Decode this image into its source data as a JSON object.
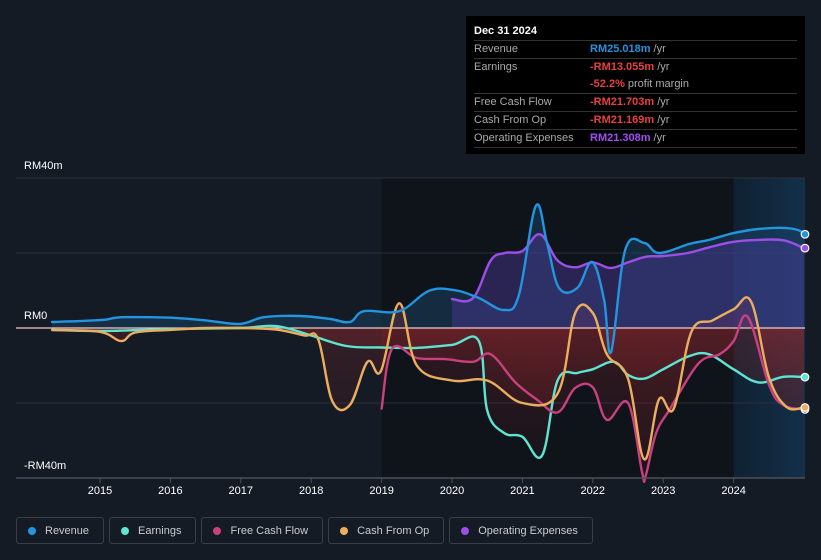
{
  "tooltip": {
    "date": "Dec 31 2024",
    "rows": [
      {
        "label": "Revenue",
        "value": "RM25.018m",
        "unit": "/yr",
        "color": "#2394df"
      },
      {
        "label": "Earnings",
        "value": "-RM13.055m",
        "unit": "/yr",
        "color": "#e64141"
      },
      {
        "label": "",
        "value": "-52.2%",
        "unit": "profit margin",
        "color": "#e64141"
      },
      {
        "label": "Free Cash Flow",
        "value": "-RM21.703m",
        "unit": "/yr",
        "color": "#e64141"
      },
      {
        "label": "Cash From Op",
        "value": "-RM21.169m",
        "unit": "/yr",
        "color": "#e64141"
      },
      {
        "label": "Operating Expenses",
        "value": "RM21.308m",
        "unit": "/yr",
        "color": "#a04ef0"
      }
    ]
  },
  "legend": [
    {
      "label": "Revenue",
      "color": "#2394df"
    },
    {
      "label": "Earnings",
      "color": "#5ee5d2"
    },
    {
      "label": "Free Cash Flow",
      "color": "#c9407f"
    },
    {
      "label": "Cash From Op",
      "color": "#eaae5e"
    },
    {
      "label": "Operating Expenses",
      "color": "#9d4ee8"
    }
  ],
  "chart_data": {
    "type": "line",
    "title": "",
    "xlabel": "",
    "ylabel": "",
    "y_tick_labels": [
      "RM40m",
      "RM0",
      "-RM40m"
    ],
    "ylim": [
      -40,
      40
    ],
    "xlim": [
      2014.3,
      2025.0
    ],
    "x_tick_labels": [
      "2015",
      "2016",
      "2017",
      "2018",
      "2019",
      "2020",
      "2021",
      "2022",
      "2023",
      "2024"
    ],
    "x_ticks": [
      2015,
      2016,
      2017,
      2018,
      2019,
      2020,
      2021,
      2022,
      2023,
      2024
    ],
    "grid": true,
    "forecast_shade_from": 2024.0,
    "legend_position": "bottom-left",
    "series": [
      {
        "name": "Revenue",
        "color": "#2394df",
        "fill": true,
        "x": [
          2014.32,
          2015.0,
          2015.21,
          2015.43,
          2016.07,
          2016.56,
          2016.99,
          2017.34,
          2017.84,
          2018.27,
          2018.55,
          2018.75,
          2019.25,
          2019.67,
          2020.03,
          2020.38,
          2020.74,
          2020.95,
          2021.19,
          2021.35,
          2021.52,
          2021.78,
          2021.99,
          2022.16,
          2022.26,
          2022.46,
          2022.73,
          2022.94,
          2023.37,
          2023.65,
          2024.0,
          2024.35,
          2024.71,
          2024.92,
          2025.0
        ],
        "y": [
          1.6,
          2.1,
          2.7,
          2.9,
          2.7,
          1.9,
          1.1,
          2.9,
          3.2,
          2.4,
          1.6,
          4.5,
          4.5,
          9.9,
          10.1,
          8.0,
          4.8,
          8.8,
          32.5,
          22.7,
          10.7,
          10.7,
          17.6,
          7.5,
          -6.4,
          20.8,
          22.7,
          20.0,
          22.4,
          23.5,
          25.3,
          26.4,
          26.7,
          26.1,
          25.0
        ]
      },
      {
        "name": "Earnings",
        "color": "#5ee5d2",
        "fill": true,
        "x": [
          2014.32,
          2015.0,
          2016.0,
          2017.0,
          2017.5,
          2018.0,
          2018.5,
          2019.0,
          2019.5,
          2020.0,
          2020.38,
          2020.5,
          2020.74,
          2021.0,
          2021.28,
          2021.5,
          2021.78,
          2022.0,
          2022.3,
          2022.5,
          2022.73,
          2023.0,
          2023.37,
          2023.65,
          2024.0,
          2024.35,
          2024.71,
          2025.0
        ],
        "y": [
          -0.5,
          -0.8,
          -0.3,
          0.0,
          0.5,
          -2.0,
          -4.8,
          -5.2,
          -5.3,
          -4.5,
          -3.5,
          -22.0,
          -28.0,
          -29.0,
          -34.0,
          -14.0,
          -12.0,
          -11.0,
          -9.0,
          -12.5,
          -13.5,
          -11.0,
          -7.5,
          -7.0,
          -11.0,
          -14.5,
          -13.0,
          -13.1
        ]
      },
      {
        "name": "Free Cash Flow",
        "color": "#c9407f",
        "fill": true,
        "x": [
          2019.0,
          2019.15,
          2019.5,
          2019.9,
          2020.3,
          2020.55,
          2020.9,
          2021.2,
          2021.5,
          2021.75,
          2022.0,
          2022.2,
          2022.5,
          2022.7,
          2022.75,
          2022.9,
          2023.1,
          2023.5,
          2023.8,
          2024.0,
          2024.2,
          2024.5,
          2024.7,
          2025.0
        ],
        "y": [
          -21.5,
          -5.5,
          -8.0,
          -8.3,
          -9.0,
          -7.0,
          -14.5,
          -19.0,
          -22.5,
          -16.0,
          -15.8,
          -24.5,
          -20.0,
          -38.5,
          -39.5,
          -28.0,
          -21.5,
          -9.5,
          -7.0,
          -3.5,
          3.0,
          -15.0,
          -20.5,
          -21.7
        ]
      },
      {
        "name": "Cash From Op",
        "color": "#eaae5e",
        "fill": true,
        "x": [
          2014.32,
          2015.0,
          2015.3,
          2015.5,
          2016.0,
          2016.5,
          2017.0,
          2017.5,
          2017.9,
          2018.1,
          2018.3,
          2018.55,
          2018.8,
          2018.99,
          2019.25,
          2019.5,
          2020.0,
          2020.5,
          2021.0,
          2021.5,
          2021.75,
          2022.0,
          2022.2,
          2022.5,
          2022.73,
          2022.94,
          2023.15,
          2023.4,
          2023.7,
          2024.0,
          2024.25,
          2024.5,
          2024.75,
          2025.0
        ],
        "y": [
          -0.5,
          -1.0,
          -3.5,
          -1.2,
          -0.5,
          0.0,
          0.0,
          -0.4,
          -2.0,
          -3.0,
          -19.5,
          -20.5,
          -9.0,
          -11.5,
          6.6,
          -10.0,
          -14.0,
          -14.0,
          -20.0,
          -17.5,
          4.0,
          4.0,
          -7.0,
          -13.5,
          -35.0,
          -19.0,
          -21.5,
          -1.0,
          2.0,
          5.0,
          7.0,
          -13.0,
          -21.0,
          -21.2
        ]
      },
      {
        "name": "Operating Expenses",
        "color": "#9d4ee8",
        "fill": true,
        "x": [
          2020.0,
          2020.3,
          2020.55,
          2020.75,
          2021.0,
          2021.25,
          2021.5,
          2021.75,
          2022.0,
          2022.25,
          2022.5,
          2022.75,
          2023.0,
          2023.35,
          2023.65,
          2024.0,
          2024.35,
          2024.71,
          2025.0
        ],
        "y": [
          7.7,
          8.0,
          18.0,
          20.0,
          20.5,
          25.0,
          18.0,
          16.2,
          17.5,
          16.0,
          17.5,
          19.0,
          19.2,
          20.0,
          21.5,
          23.0,
          23.5,
          23.4,
          21.3
        ]
      }
    ]
  }
}
